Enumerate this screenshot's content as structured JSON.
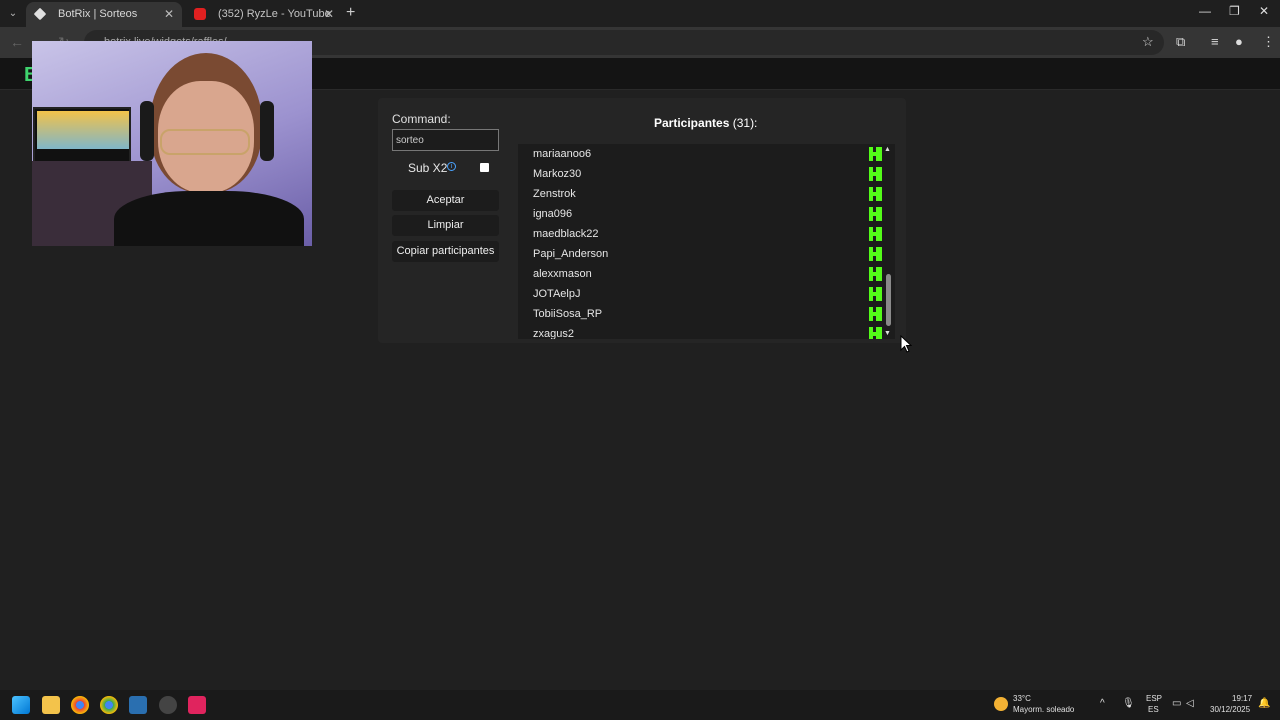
{
  "browser": {
    "tabs": [
      {
        "title": "BotRix | Sorteos",
        "active": true
      },
      {
        "title": "(352) RyzLe - YouTube",
        "active": false
      }
    ],
    "address": "botrix.live/widgets/raffles/"
  },
  "site": {
    "logo": "B"
  },
  "form": {
    "command_label": "Command:",
    "command_value": "sorteo",
    "subx2_label": "Sub X2",
    "accept_label": "Aceptar",
    "clear_label": "Limpiar",
    "copy_label": "Copiar participantes"
  },
  "participants": {
    "title": "Participantes",
    "count": "(31):",
    "items": [
      "mariaanoo6",
      "Markoz30",
      "Zenstrok",
      "igna096",
      "maedblack22",
      "Papi_Anderson",
      "alexxmason",
      "JOTAelpJ",
      "TobiiSosa_RP",
      "zxagus2"
    ]
  },
  "taskbar": {
    "temperature": "33°C",
    "weather": "Mayorm. soleado",
    "lang1": "ESP",
    "lang2": "ES",
    "time": "19:17",
    "date": "30/12/2025"
  }
}
